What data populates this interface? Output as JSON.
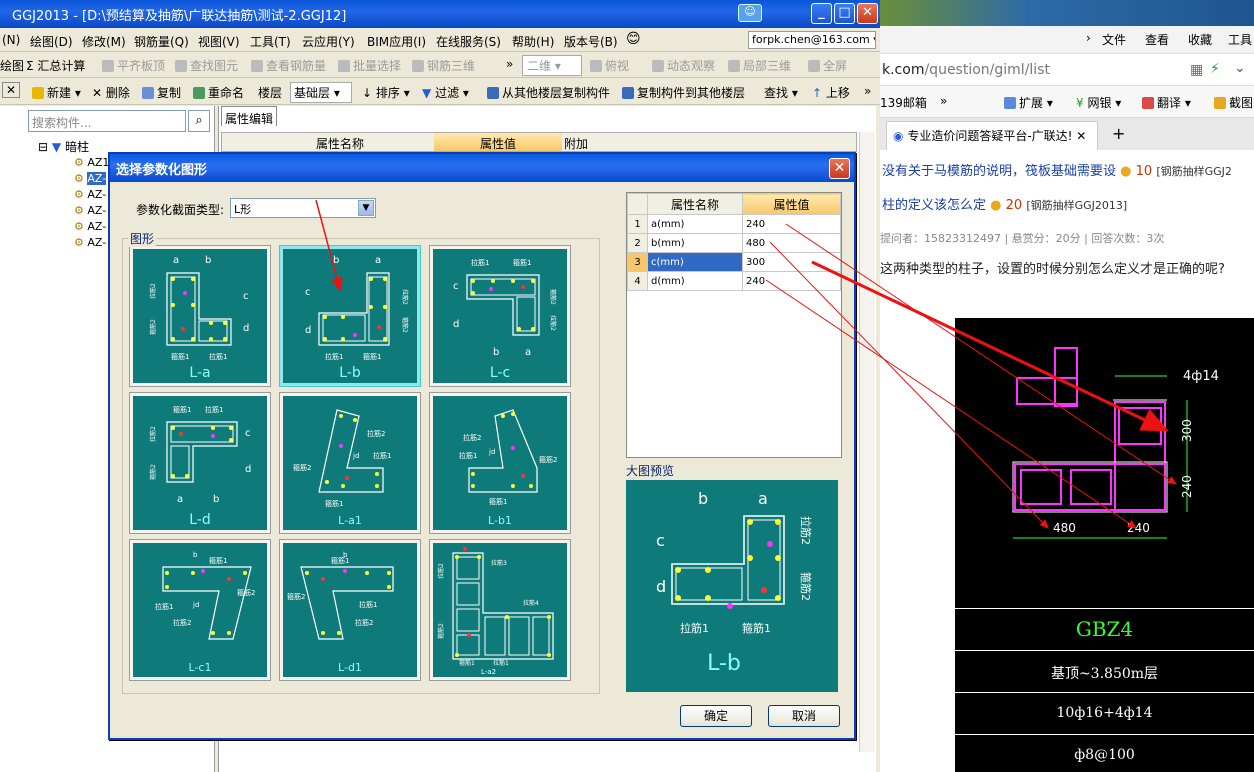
{
  "app": {
    "title": "GGJ2013 - [D:\\预结算及抽筋\\广联达抽筋\\测试-2.GGJ12]",
    "menus": [
      "(N)",
      "绘图(D)",
      "修改(M)",
      "钢筋量(Q)",
      "视图(V)",
      "工具(T)",
      "云应用(Y)",
      "BIM应用(I)",
      "在线服务(S)",
      "帮助(H)",
      "版本号(B)"
    ],
    "email": "forpk.chen@163.com",
    "toolbar1": [
      "绘图",
      "Σ 汇总计算",
      "平齐板顶",
      "查找图元",
      "查看钢筋量",
      "批量选择",
      "钢筋三维",
      "二维",
      "俯视",
      "动态观察",
      "局部三维",
      "全屏"
    ],
    "toolbar2": [
      "新建",
      "删除",
      "复制",
      "重命名",
      "楼层",
      "基础层",
      "排序",
      "过滤",
      "从其他楼层复制构件",
      "复制构件到其他楼层",
      "查找",
      "上移"
    ],
    "search_placeholder": "搜索构件...",
    "tree_root": "暗柱",
    "tree_items": [
      "AZ1",
      "AZ-",
      "AZ-",
      "AZ-",
      "AZ-",
      "AZ-"
    ],
    "prop_tab": "属性编辑",
    "prop_headers": [
      "属性名称",
      "属性值",
      "附加"
    ]
  },
  "dialog": {
    "title": "选择参数化图形",
    "type_label": "参数化截面类型:",
    "type_value": "L形",
    "graph_label": "图形",
    "shapes": [
      "L-a",
      "L-b",
      "L-c",
      "L-d",
      "L-a1",
      "L-b1",
      "L-c1",
      "L-d1",
      "L-a2"
    ],
    "shape_notes": {
      "la": [
        "a",
        "b",
        "c",
        "d",
        "拉筋2",
        "箍筋2",
        "箍筋1",
        "拉筋1"
      ],
      "lb": [
        "b",
        "a",
        "c",
        "d",
        "拉筋2",
        "箍筋2",
        "拉筋1",
        "箍筋1"
      ],
      "lc": [
        "拉筋1",
        "箍筋1",
        "c",
        "d",
        "箍筋2",
        "拉筋2",
        "b",
        "a"
      ],
      "ld": [
        "箍筋1",
        "拉筋1",
        "c",
        "d",
        "拉筋2",
        "箍筋2",
        "a",
        "b"
      ],
      "la1": [
        "拉筋2",
        "jd",
        "拉筋1",
        "箍筋2",
        "箍筋1"
      ],
      "lb1": [
        "拉筋2",
        "jd",
        "拉筋1",
        "箍筋2",
        "箍筋1"
      ],
      "lc1": [
        "b",
        "箍筋1",
        "拉筋1",
        "jd",
        "箍筋2",
        "拉筋2"
      ],
      "ld1": [
        "b",
        "箍筋1",
        "拉筋1",
        "箍筋2",
        "拉筋2"
      ],
      "la2": [
        "拉筋3",
        "拉筋4",
        "拉筋2",
        "箍筋2",
        "箍筋1",
        "拉筋1"
      ]
    },
    "selected_shape": "L-b",
    "grid_headers": [
      "属性名称",
      "属性值"
    ],
    "grid_rows": [
      {
        "n": "1",
        "name": "a(mm)",
        "value": "240"
      },
      {
        "n": "2",
        "name": "b(mm)",
        "value": "480"
      },
      {
        "n": "3",
        "name": "c(mm)",
        "value": "300"
      },
      {
        "n": "4",
        "name": "d(mm)",
        "value": "240"
      }
    ],
    "preview_label": "大图预览",
    "preview_notes": [
      "b",
      "a",
      "c",
      "d",
      "拉筋2",
      "箍筋2",
      "拉筋1",
      "箍筋1"
    ],
    "ok": "确定",
    "cancel": "取消"
  },
  "browser": {
    "menu": [
      "文件",
      "查看",
      "收藏",
      "工具"
    ],
    "url_host": "k.com",
    "url_path": "/question/giml/list",
    "bookmarks": [
      "139邮箱",
      "扩展",
      "网银",
      "翻译",
      "截图"
    ],
    "tab_title": "专业造价问题答疑平台-广联达!",
    "q1_text": "没有关于马模筋的说明，筏板基础需要设",
    "q1_score": "10",
    "q1_tag": "[钢筋抽样GGJ2",
    "q2_text": "柱的定义该怎么定",
    "q2_score": "20",
    "q2_tag": "[钢筋抽样GGJ2013]",
    "meta": "提问者：15823312497  |  悬赏分：20分  |  回答次数：3次",
    "body": "这两种类型的柱子，设置的时候分别怎么定义才是正确的呢?",
    "colors": {
      "link": "#1a3fa8",
      "score": "#cc6600"
    }
  },
  "cad": {
    "dims": [
      "4ф14",
      "300",
      "240",
      "480",
      "240"
    ],
    "rows": [
      "GBZ4",
      "基顶~3.850m层",
      "10ф16+4ф14",
      "ф8@100"
    ],
    "colors": {
      "green": "#33ff33",
      "magenta": "#ff33ff",
      "red": "#ff2020"
    }
  }
}
